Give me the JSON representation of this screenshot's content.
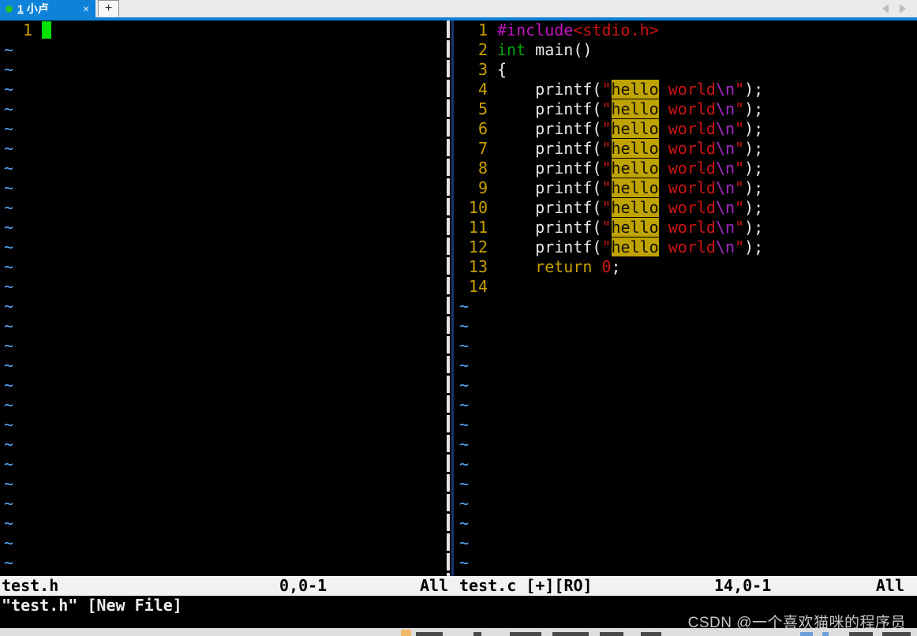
{
  "tabbar": {
    "active_tab": {
      "number": "1",
      "title": "小卢",
      "close_label": "×"
    },
    "new_tab_label": "+"
  },
  "colors": {
    "accent_blue": "#0d82d8",
    "session_dot_green": "#21c32b",
    "cursor_green": "#00e002",
    "line_number_gold": "#c8a000",
    "tilde_blue": "#54a8f8",
    "preproc_magenta": "#c213c2",
    "string_red": "#cc1414",
    "type_green": "#00a400",
    "special_purple": "#a629c6",
    "search_highlight_bg": "#bfa300",
    "status_bg": "#f2f2f2"
  },
  "left_pane": {
    "active_line_number": "1",
    "tilde": "~",
    "tilde_rows": 27
  },
  "right_pane": {
    "tilde": "~",
    "tilde_rows": 14,
    "lines": [
      {
        "num": "1",
        "tokens": [
          {
            "t": "#include",
            "c": "pre"
          },
          {
            "t": "<stdio.h>",
            "c": "str"
          }
        ]
      },
      {
        "num": "2",
        "tokens": [
          {
            "t": "int",
            "c": "typ"
          },
          {
            "t": " main()",
            "c": "plain"
          }
        ]
      },
      {
        "num": "3",
        "tokens": [
          {
            "t": "{",
            "c": "plain"
          }
        ]
      },
      {
        "num": "4",
        "tokens": [
          {
            "t": "    printf(",
            "c": "plain"
          },
          {
            "t": "\"",
            "c": "str"
          },
          {
            "t": "hello",
            "c": "hl"
          },
          {
            "t": " world",
            "c": "str"
          },
          {
            "t": "\\n",
            "c": "spc"
          },
          {
            "t": "\"",
            "c": "str"
          },
          {
            "t": ");",
            "c": "plain"
          }
        ]
      },
      {
        "num": "5",
        "tokens": [
          {
            "t": "    printf(",
            "c": "plain"
          },
          {
            "t": "\"",
            "c": "str"
          },
          {
            "t": "hello",
            "c": "hl"
          },
          {
            "t": " world",
            "c": "str"
          },
          {
            "t": "\\n",
            "c": "spc"
          },
          {
            "t": "\"",
            "c": "str"
          },
          {
            "t": ");",
            "c": "plain"
          }
        ]
      },
      {
        "num": "6",
        "tokens": [
          {
            "t": "    printf(",
            "c": "plain"
          },
          {
            "t": "\"",
            "c": "str"
          },
          {
            "t": "hello",
            "c": "hl"
          },
          {
            "t": " world",
            "c": "str"
          },
          {
            "t": "\\n",
            "c": "spc"
          },
          {
            "t": "\"",
            "c": "str"
          },
          {
            "t": ");",
            "c": "plain"
          }
        ]
      },
      {
        "num": "7",
        "tokens": [
          {
            "t": "    printf(",
            "c": "plain"
          },
          {
            "t": "\"",
            "c": "str"
          },
          {
            "t": "hello",
            "c": "hl"
          },
          {
            "t": " world",
            "c": "str"
          },
          {
            "t": "\\n",
            "c": "spc"
          },
          {
            "t": "\"",
            "c": "str"
          },
          {
            "t": ");",
            "c": "plain"
          }
        ]
      },
      {
        "num": "8",
        "tokens": [
          {
            "t": "    printf(",
            "c": "plain"
          },
          {
            "t": "\"",
            "c": "str"
          },
          {
            "t": "hello",
            "c": "hl"
          },
          {
            "t": " world",
            "c": "str"
          },
          {
            "t": "\\n",
            "c": "spc"
          },
          {
            "t": "\"",
            "c": "str"
          },
          {
            "t": ");",
            "c": "plain"
          }
        ]
      },
      {
        "num": "9",
        "tokens": [
          {
            "t": "    printf(",
            "c": "plain"
          },
          {
            "t": "\"",
            "c": "str"
          },
          {
            "t": "hello",
            "c": "hl"
          },
          {
            "t": " world",
            "c": "str"
          },
          {
            "t": "\\n",
            "c": "spc"
          },
          {
            "t": "\"",
            "c": "str"
          },
          {
            "t": ");",
            "c": "plain"
          }
        ]
      },
      {
        "num": "10",
        "tokens": [
          {
            "t": "    printf(",
            "c": "plain"
          },
          {
            "t": "\"",
            "c": "str"
          },
          {
            "t": "hello",
            "c": "hl"
          },
          {
            "t": " world",
            "c": "str"
          },
          {
            "t": "\\n",
            "c": "spc"
          },
          {
            "t": "\"",
            "c": "str"
          },
          {
            "t": ");",
            "c": "plain"
          }
        ]
      },
      {
        "num": "11",
        "tokens": [
          {
            "t": "    printf(",
            "c": "plain"
          },
          {
            "t": "\"",
            "c": "str"
          },
          {
            "t": "hello",
            "c": "hl"
          },
          {
            "t": " world",
            "c": "str"
          },
          {
            "t": "\\n",
            "c": "spc"
          },
          {
            "t": "\"",
            "c": "str"
          },
          {
            "t": ");",
            "c": "plain"
          }
        ]
      },
      {
        "num": "12",
        "tokens": [
          {
            "t": "    printf(",
            "c": "plain"
          },
          {
            "t": "\"",
            "c": "str"
          },
          {
            "t": "hello",
            "c": "hl"
          },
          {
            "t": " world",
            "c": "str"
          },
          {
            "t": "\\n",
            "c": "spc"
          },
          {
            "t": "\"",
            "c": "str"
          },
          {
            "t": ");",
            "c": "plain"
          }
        ]
      },
      {
        "num": "13",
        "tokens": [
          {
            "t": "    ",
            "c": "plain"
          },
          {
            "t": "return",
            "c": "kw"
          },
          {
            "t": " ",
            "c": "plain"
          },
          {
            "t": "0",
            "c": "cst"
          },
          {
            "t": ";",
            "c": "plain"
          }
        ]
      },
      {
        "num": "14",
        "tokens": []
      }
    ]
  },
  "statusline": {
    "left": {
      "file": "test.h",
      "ruler": "0,0-1",
      "scroll": "All"
    },
    "right": {
      "file": "test.c",
      "flags": "[+][RO]",
      "ruler": "14,0-1",
      "scroll": "All"
    }
  },
  "cmdline": {
    "text": "\"test.h\" [New File]"
  },
  "watermark": {
    "text": "CSDN @一个喜欢猫咪的程序员"
  }
}
